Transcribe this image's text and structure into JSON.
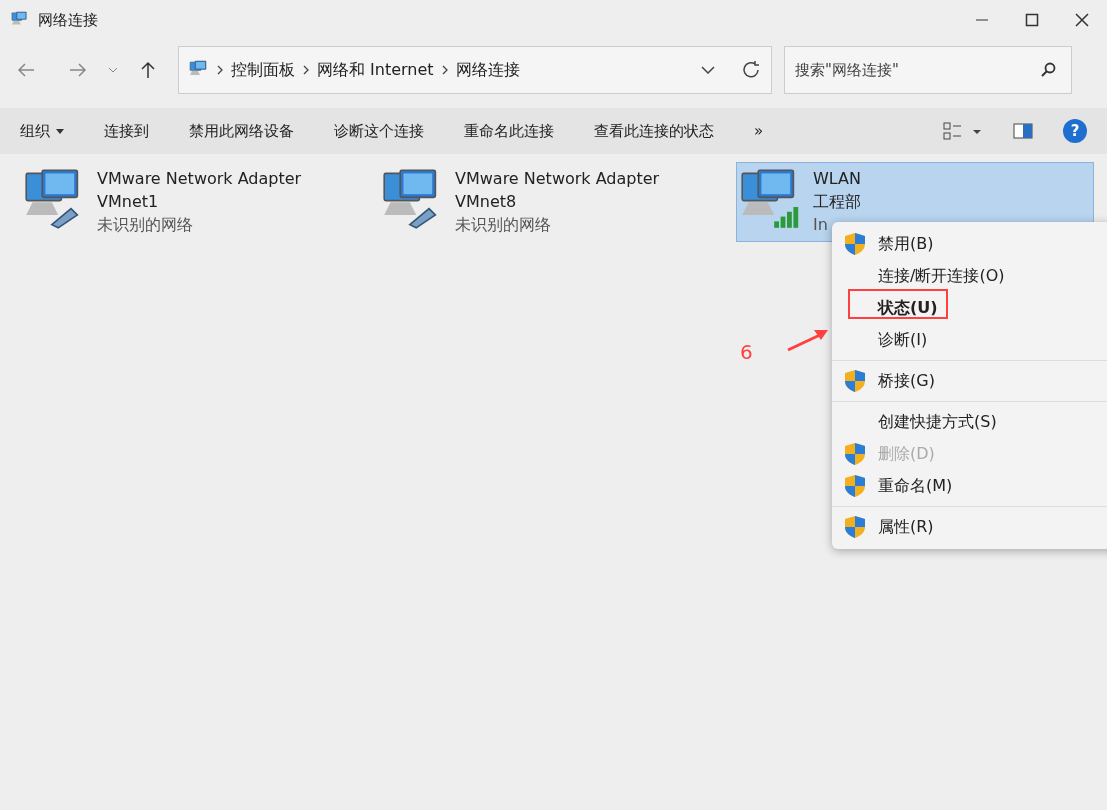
{
  "window": {
    "title": "网络连接"
  },
  "address": {
    "crumbs": [
      "控制面板",
      "网络和 Internet",
      "网络连接"
    ]
  },
  "search": {
    "placeholder": "搜索\"网络连接\""
  },
  "commands": [
    {
      "label": "组织",
      "dropdown": true
    },
    {
      "label": "连接到",
      "dropdown": false
    },
    {
      "label": "禁用此网络设备",
      "dropdown": false
    },
    {
      "label": "诊断这个连接",
      "dropdown": false
    },
    {
      "label": "重命名此连接",
      "dropdown": false
    },
    {
      "label": "查看此连接的状态",
      "dropdown": false
    },
    {
      "label": "»",
      "dropdown": false
    }
  ],
  "adapters": [
    {
      "kind": "ethernet",
      "name": "VMware Network Adapter",
      "device": "VMnet1",
      "status": "未识别的网络",
      "selected": false
    },
    {
      "kind": "ethernet",
      "name": "VMware Network Adapter",
      "device": "VMnet8",
      "status": "未识别的网络",
      "selected": false
    },
    {
      "kind": "wifi",
      "name": "WLAN",
      "device": "工程部",
      "status": "In",
      "selected": true
    }
  ],
  "context_menu": [
    {
      "kind": "item",
      "label": "禁用(B)",
      "shield": true,
      "bold": false,
      "disabled": false,
      "marked": false
    },
    {
      "kind": "item",
      "label": "连接/断开连接(O)",
      "shield": false,
      "bold": false,
      "disabled": false,
      "marked": false
    },
    {
      "kind": "item",
      "label": "状态(U)",
      "shield": false,
      "bold": true,
      "disabled": false,
      "marked": true
    },
    {
      "kind": "item",
      "label": "诊断(I)",
      "shield": false,
      "bold": false,
      "disabled": false,
      "marked": false
    },
    {
      "kind": "separator"
    },
    {
      "kind": "item",
      "label": "桥接(G)",
      "shield": true,
      "bold": false,
      "disabled": false,
      "marked": false
    },
    {
      "kind": "separator"
    },
    {
      "kind": "item",
      "label": "创建快捷方式(S)",
      "shield": false,
      "bold": false,
      "disabled": false,
      "marked": false
    },
    {
      "kind": "item",
      "label": "删除(D)",
      "shield": true,
      "bold": false,
      "disabled": true,
      "marked": false
    },
    {
      "kind": "item",
      "label": "重命名(M)",
      "shield": true,
      "bold": false,
      "disabled": false,
      "marked": false
    },
    {
      "kind": "separator"
    },
    {
      "kind": "item",
      "label": "属性(R)",
      "shield": true,
      "bold": false,
      "disabled": false,
      "marked": false
    }
  ],
  "help": {
    "label": "?"
  },
  "annotation": {
    "label": "6"
  }
}
